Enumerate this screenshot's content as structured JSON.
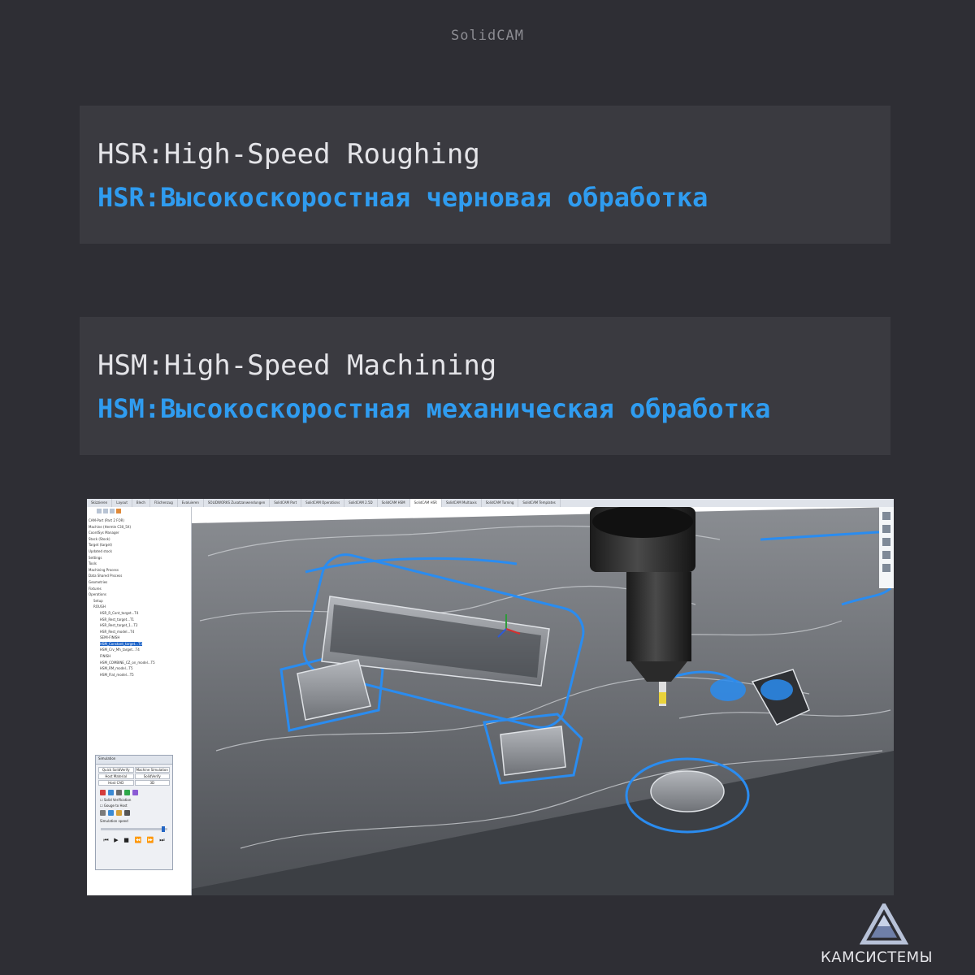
{
  "header": {
    "brand": "SolidCAM"
  },
  "cards": [
    {
      "en": "HSR:High-Speed Roughing",
      "ru": "HSR:Высокоскоростная черновая обработка"
    },
    {
      "en": "HSM:High-Speed Machining",
      "ru": "HSM:Высокоскоростная механическая обработка"
    }
  ],
  "screenshot": {
    "tabs": [
      "Skizzieren",
      "Layout",
      "Blech",
      "Flächenzug",
      "Evaluieren",
      "SOLIDWORKS Zusatzanwendungen",
      "SolidCAM Part",
      "SolidCAM Operations",
      "SolidCAM 2.5D",
      "SolidCAM HSM",
      "SolidCAM HSR",
      "SolidCAM Multiaxis",
      "SolidCAM Turning",
      "SolidCAM Templates"
    ],
    "active_tab_index": 10,
    "tree": [
      "CAM-Part (Part 2 FOR)",
      "Machine (Hermle C30_5X)",
      "CoordSys Manager",
      "Stock (Stock)",
      "Target (target)",
      "Updated stock",
      "Settings",
      "Tools",
      "Machining Process",
      "Data Shared Process",
      "Geometries",
      "Fixtures",
      "Operations",
      "Setup",
      "ROUGH",
      "HSR_R_Cont_target...T4",
      "HSR_Rest_target...T1",
      "HSR_Rest_target_1...T2",
      "HSR_Rest_model...T4",
      "SEMI-FINISH",
      "HSM_Constant_target...T3",
      "HSM_Crv_Mh_target...T4",
      "FINISH",
      "HSM_COMBINE_CZ_on_model...T5",
      "HSM_RM_model...T5",
      "HSM_Flat_model...T5"
    ],
    "selected_tree_index": 20,
    "simulation": {
      "title": "Simulation",
      "tabs": [
        "Quick SolidVerify",
        "Machine Simulation",
        "Host Material",
        "SolidVerify",
        "Host CAD",
        "3D"
      ],
      "check_solid": "Solid Verification",
      "check_gouge": "Gouge to Host",
      "speed_label": "Simulation speed"
    }
  },
  "logo": {
    "text": "КАМСИСТЕМЫ"
  },
  "colors": {
    "background": "#2e2e34",
    "card": "#3a3a40",
    "accent": "#2f9cf0",
    "text": "#e4e4e8"
  }
}
